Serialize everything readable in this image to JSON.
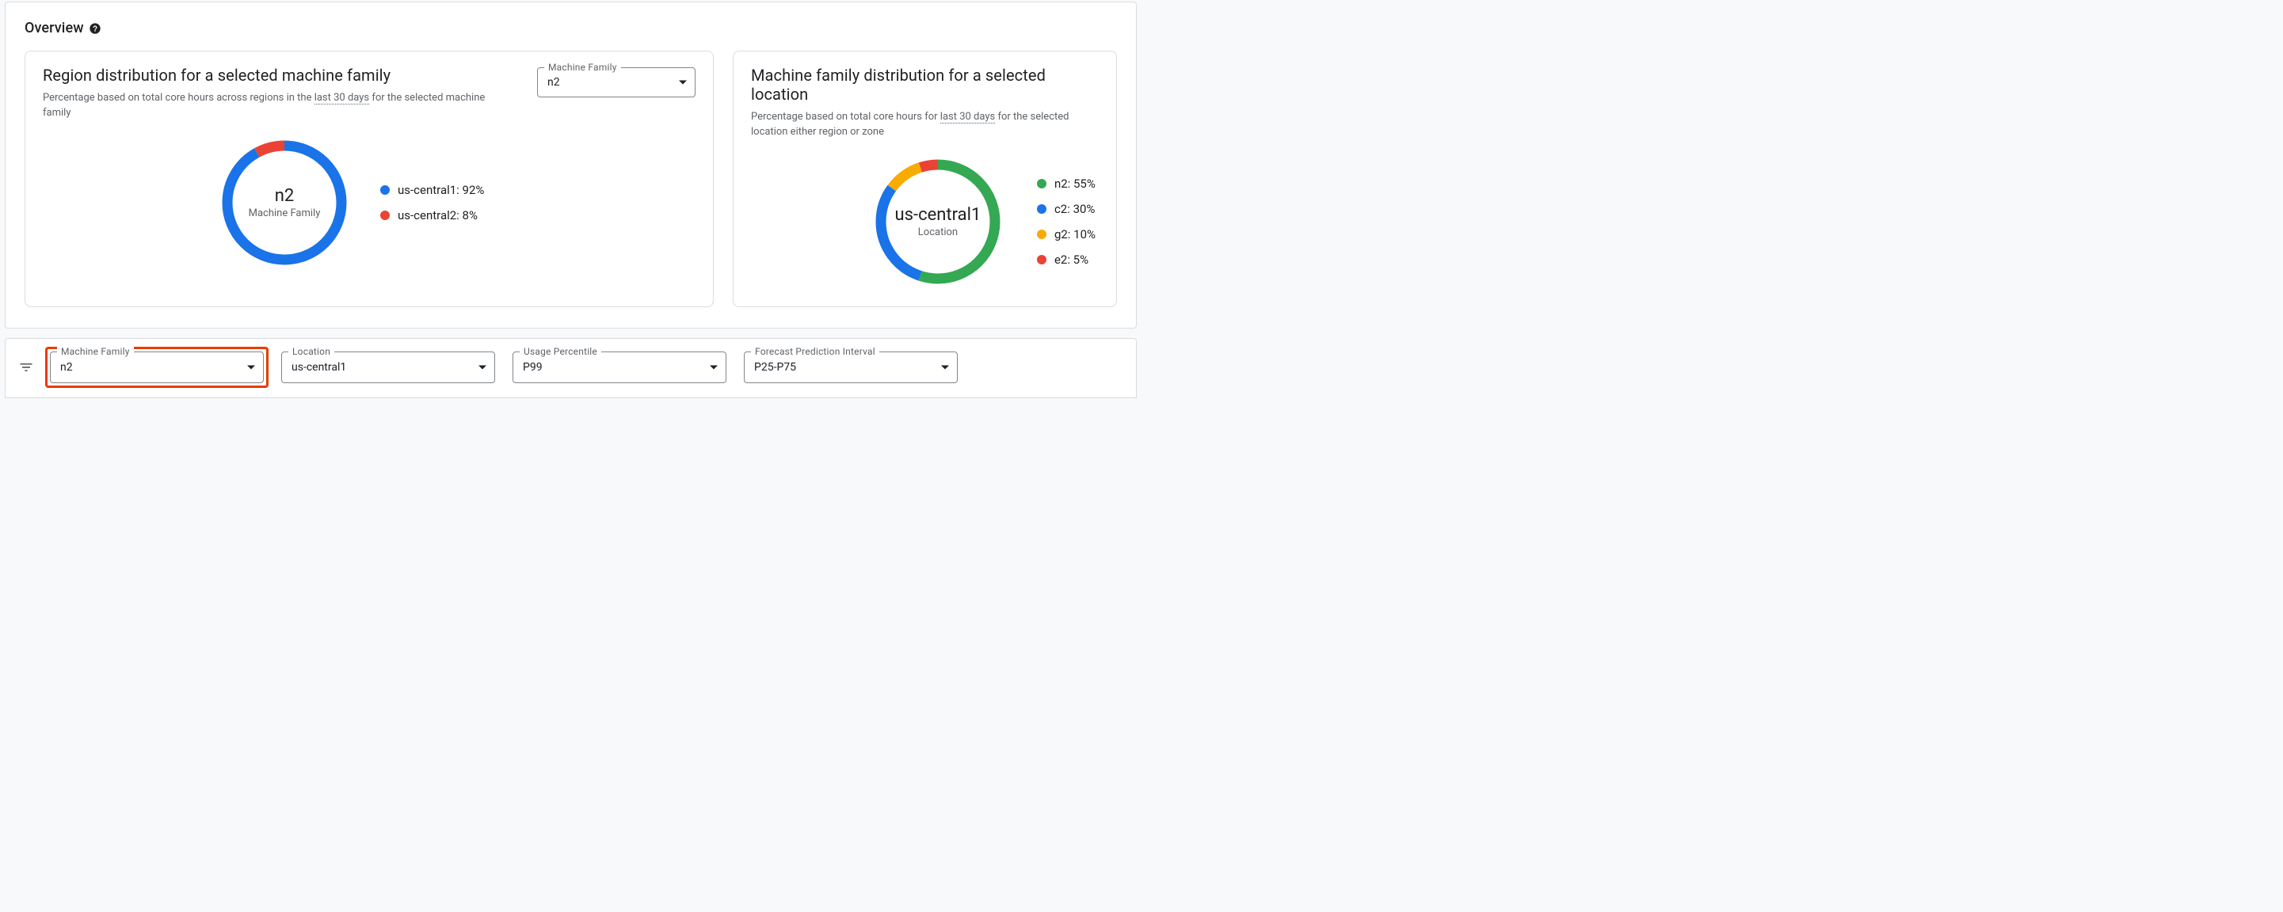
{
  "overview": {
    "title": "Overview"
  },
  "card_region": {
    "title": "Region distribution for a selected machine family",
    "subtitle_pre": "Percentage based on total core hours across regions in the ",
    "subtitle_link": "last 30 days",
    "subtitle_post": " for the selected machine family",
    "select_label": "Machine Family",
    "select_value": "n2",
    "donut_center_value": "n2",
    "donut_center_label": "Machine Family"
  },
  "card_family": {
    "title": "Machine family distribution for a selected location",
    "subtitle_pre": "Percentage based on total core hours for ",
    "subtitle_link": "last 30 days",
    "subtitle_post": " for the selected location either region or zone",
    "donut_center_value": "us-central1",
    "donut_center_label": "Location"
  },
  "chart_data": [
    {
      "type": "pie",
      "title": "Region distribution for a selected machine family",
      "series": [
        {
          "name": "us-central1",
          "value": 92,
          "color": "#1a73e8"
        },
        {
          "name": "us-central2",
          "value": 8,
          "color": "#ea4335"
        }
      ],
      "center_label": "n2",
      "center_sublabel": "Machine Family"
    },
    {
      "type": "pie",
      "title": "Machine family distribution for a selected location",
      "series": [
        {
          "name": "n2",
          "value": 55,
          "color": "#34a853"
        },
        {
          "name": "c2",
          "value": 30,
          "color": "#1a73e8"
        },
        {
          "name": "g2",
          "value": 10,
          "color": "#f9ab00"
        },
        {
          "name": "e2",
          "value": 5,
          "color": "#ea4335"
        }
      ],
      "center_label": "us-central1",
      "center_sublabel": "Location"
    }
  ],
  "legend_region": {
    "0": "us-central1: 92%",
    "1": "us-central2: 8%"
  },
  "legend_family": {
    "0": "n2: 55%",
    "1": "c2: 30%",
    "2": "g2: 10%",
    "3": "e2: 5%"
  },
  "filters": {
    "machine_family": {
      "label": "Machine Family",
      "value": "n2"
    },
    "location": {
      "label": "Location",
      "value": "us-central1"
    },
    "usage_percentile": {
      "label": "Usage Percentile",
      "value": "P99"
    },
    "forecast_interval": {
      "label": "Forecast Prediction Interval",
      "value": "P25-P75"
    }
  },
  "colors": {
    "blue": "#1a73e8",
    "red": "#ea4335",
    "green": "#34a853",
    "amber": "#f9ab00"
  }
}
